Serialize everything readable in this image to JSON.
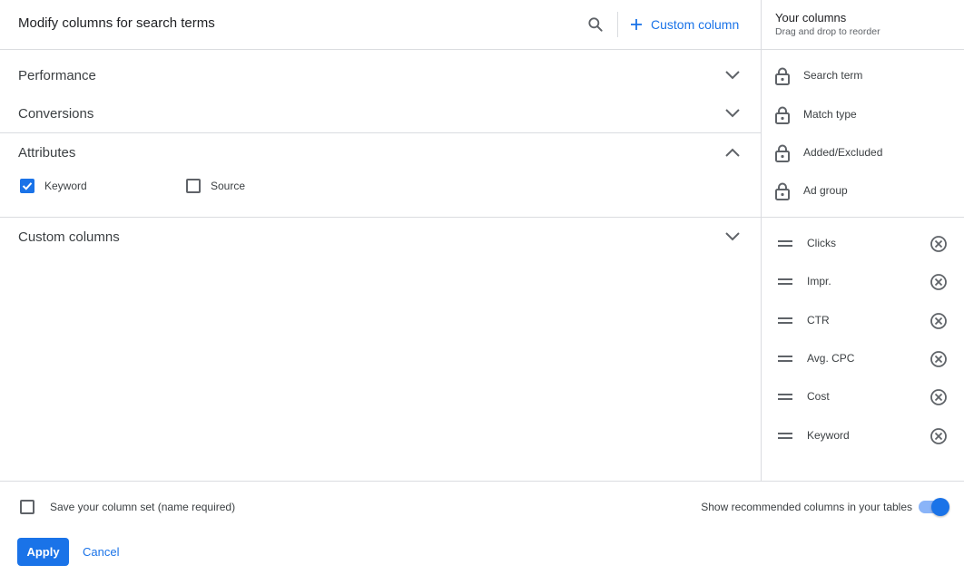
{
  "header": {
    "title": "Modify columns for search terms",
    "custom_column_label": "Custom column"
  },
  "sections": [
    {
      "label": "Performance",
      "expanded": false
    },
    {
      "label": "Conversions",
      "expanded": false
    },
    {
      "label": "Attributes",
      "expanded": true,
      "options": [
        {
          "label": "Keyword",
          "checked": true
        },
        {
          "label": "Source",
          "checked": false
        }
      ]
    },
    {
      "label": "Custom columns",
      "expanded": false
    }
  ],
  "your_columns": {
    "title": "Your columns",
    "subtitle": "Drag and drop to reorder",
    "locked": [
      "Search term",
      "Match type",
      "Added/Excluded",
      "Ad group"
    ],
    "movable": [
      "Clicks",
      "Impr.",
      "CTR",
      "Avg. CPC",
      "Cost",
      "Keyword"
    ]
  },
  "footer": {
    "save_label": "Save your column set (name required)",
    "save_checked": false,
    "show_recommended_label": "Show recommended columns in your tables",
    "show_recommended_on": true,
    "apply_label": "Apply",
    "cancel_label": "Cancel"
  },
  "colors": {
    "accent": "#1a73e8",
    "toggle_track": "#8ab4f8",
    "divider": "#dadce0",
    "icon": "#5f6368"
  },
  "icons": {
    "search": "search-icon",
    "add": "plus-icon",
    "collapse": "chevron-down-icon",
    "expand": "chevron-up-icon",
    "locked": "lock-icon",
    "drag": "drag-handle-icon",
    "remove": "remove-circle-icon"
  }
}
